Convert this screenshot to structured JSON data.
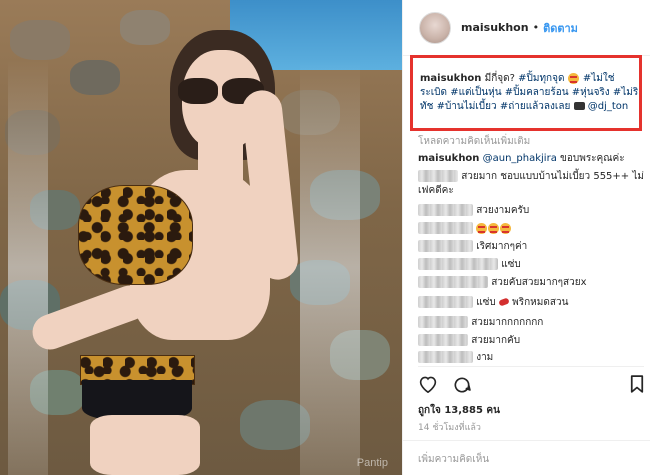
{
  "header": {
    "username": "maisukhon",
    "separator": "•",
    "follow_label": "ติดตาม"
  },
  "caption": {
    "username": "maisukhon",
    "text_1": "มีกี่จุด? ",
    "tag_1": "#ปิ้มทุกจุด",
    "text_2": " ",
    "tag_2": "#ไม่ใช่ระเบิด",
    "tag_3": "#แต่เป็นหุ่น",
    "tag_4": "#ปิ้มคลายร้อน",
    "tag_5": "#หุ่นจริง",
    "tag_6": "#ไม่ริทัช",
    "tag_7": "#บ้านไม่เบี้ยว",
    "tag_8": "#ถ่ายแล้วลงเลย",
    "mention": "@dj_ton"
  },
  "load_more_label": "โหลดความคิดเห็นเพิ่มเติม",
  "comments": [
    {
      "user": "maisukhon",
      "mention": "@aun_phakjira",
      "text": "ขอบพระคุณค่ะ"
    },
    {
      "text": "สวยมาก ชอบแบบบ้านไม่เบี้ยว 555++ ไม่เฟคดีคะ"
    },
    {
      "text": "สวยงามครับ"
    },
    {
      "text": ""
    },
    {
      "text": "เริศมากๆค่า"
    },
    {
      "text": "แซ่บ"
    },
    {
      "text": "สวยคับสวยมากๆสวยx"
    },
    {
      "text": "แซ่บ",
      "text_2": "พริกหมดสวน"
    },
    {
      "text": "สวยมากกกกกกก"
    },
    {
      "text": "สวยมากคับ"
    },
    {
      "text": "งาม"
    }
  ],
  "likes": "ถูกใจ 13,885 คน",
  "time": "14 ชั่วโมงที่แล้ว",
  "add_comment_placeholder": "เพิ่มความคิดเห็น",
  "watermark": "Pantip",
  "icons": {
    "like": "heart-icon",
    "comment": "comment-icon",
    "save": "bookmark-icon",
    "caption_emoji": "grinning-face-icon",
    "camera": "camera-emoji",
    "pepper": "hot-pepper-emoji",
    "heart_eyes": "heart-eyes-emoji"
  },
  "colors": {
    "link": "#003569",
    "follow": "#3897f0",
    "highlight": "#e5322d",
    "muted": "#999999"
  }
}
